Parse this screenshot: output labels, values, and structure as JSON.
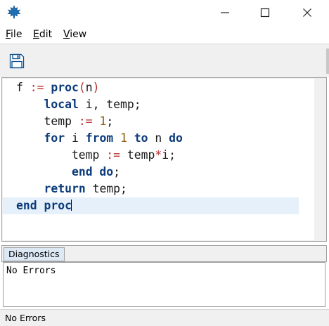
{
  "menu": {
    "file": {
      "mnemonic": "F",
      "rest": "ile"
    },
    "edit": {
      "mnemonic": "E",
      "rest": "dit"
    },
    "view": {
      "mnemonic": "V",
      "rest": "iew"
    }
  },
  "toolbar": {
    "save_icon": "save-icon"
  },
  "editor": {
    "lines": [
      [
        {
          "t": "f ",
          "c": "p"
        },
        {
          "t": ":=",
          "c": "op"
        },
        {
          "t": " ",
          "c": "p"
        },
        {
          "t": "proc",
          "c": "kw"
        },
        {
          "t": "(",
          "c": "op"
        },
        {
          "t": "n",
          "c": "p"
        },
        {
          "t": ")",
          "c": "op"
        }
      ],
      [
        {
          "t": "    ",
          "c": "p"
        },
        {
          "t": "local",
          "c": "kw"
        },
        {
          "t": " i, temp;",
          "c": "p"
        }
      ],
      [
        {
          "t": "    temp ",
          "c": "p"
        },
        {
          "t": ":=",
          "c": "op"
        },
        {
          "t": " ",
          "c": "p"
        },
        {
          "t": "1",
          "c": "num"
        },
        {
          "t": ";",
          "c": "p"
        }
      ],
      [
        {
          "t": "    ",
          "c": "p"
        },
        {
          "t": "for",
          "c": "kw"
        },
        {
          "t": " i ",
          "c": "p"
        },
        {
          "t": "from",
          "c": "kw"
        },
        {
          "t": " ",
          "c": "p"
        },
        {
          "t": "1",
          "c": "num"
        },
        {
          "t": " ",
          "c": "p"
        },
        {
          "t": "to",
          "c": "kw"
        },
        {
          "t": " n ",
          "c": "p"
        },
        {
          "t": "do",
          "c": "kw"
        }
      ],
      [
        {
          "t": "        temp ",
          "c": "p"
        },
        {
          "t": ":=",
          "c": "op"
        },
        {
          "t": " temp",
          "c": "p"
        },
        {
          "t": "*",
          "c": "op"
        },
        {
          "t": "i;",
          "c": "p"
        }
      ],
      [
        {
          "t": "        ",
          "c": "p"
        },
        {
          "t": "end do",
          "c": "kw"
        },
        {
          "t": ";",
          "c": "p"
        }
      ],
      [
        {
          "t": "    ",
          "c": "p"
        },
        {
          "t": "return",
          "c": "kw"
        },
        {
          "t": " temp;",
          "c": "p"
        }
      ],
      [
        {
          "t": "end proc",
          "c": "kw"
        }
      ]
    ],
    "current_line": 8
  },
  "diagnostics": {
    "tab_label": "Diagnostics",
    "message": "No Errors"
  },
  "status": {
    "text": "No Errors"
  },
  "colors": {
    "keyword": "#0b3b7a",
    "operator": "#b5312c",
    "number": "#8a5a00",
    "current_line": "#e6f0fb"
  }
}
